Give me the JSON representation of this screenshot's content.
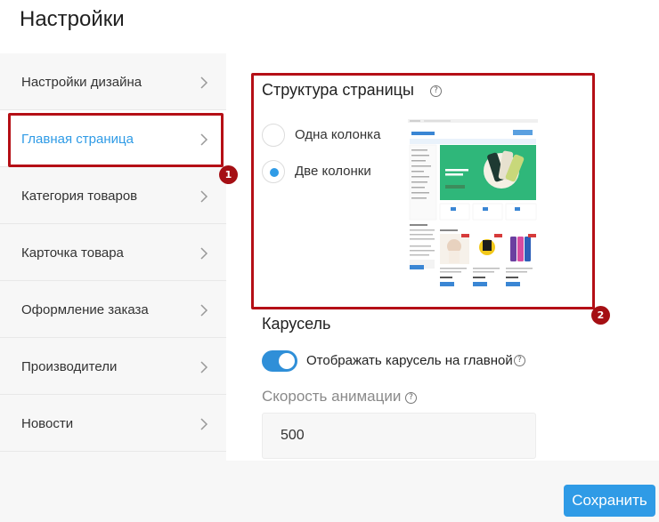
{
  "page": {
    "title": "Настройки"
  },
  "sidebar": {
    "items": [
      {
        "label": "Настройки дизайна"
      },
      {
        "label": "Главная страница"
      },
      {
        "label": "Категория товаров"
      },
      {
        "label": "Карточка товара"
      },
      {
        "label": "Оформление заказа"
      },
      {
        "label": "Производители"
      },
      {
        "label": "Новости"
      }
    ],
    "active_index": 1
  },
  "structure": {
    "title": "Структура страницы",
    "options": [
      {
        "label": "Одна колонка",
        "selected": false
      },
      {
        "label": "Две колонки",
        "selected": true
      }
    ],
    "preview_banner": "Квантовые iPhone 11"
  },
  "carousel": {
    "title": "Карусель",
    "toggle_label": "Отображать карусель на главной",
    "toggle_on": true,
    "speed_label": "Скорость анимации",
    "speed_value": "500"
  },
  "footer": {
    "save_label": "Сохранить"
  },
  "annotations": {
    "badge1": "1",
    "badge2": "2"
  },
  "icons": {
    "help": "?",
    "chevron": "chevron-right-icon"
  },
  "colors": {
    "accent": "#2f9be6",
    "annotation": "#b50f16",
    "preview_green": "#2fb77a"
  }
}
